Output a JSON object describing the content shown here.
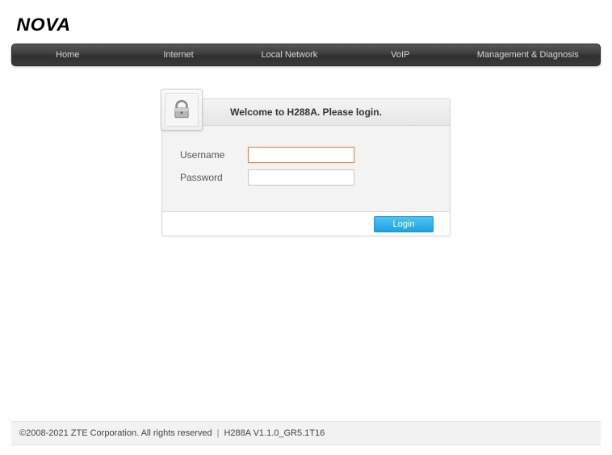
{
  "brand": "NOVA",
  "nav": {
    "items": [
      "Home",
      "Internet",
      "Local Network",
      "VoIP",
      "Management & Diagnosis"
    ]
  },
  "login": {
    "welcome": "Welcome to H288A. Please login.",
    "username_label": "Username",
    "password_label": "Password",
    "username_value": "",
    "password_value": "",
    "button": "Login",
    "icon": "lock-icon"
  },
  "footer": {
    "copyright": "©2008-2021 ZTE Corporation. All rights reserved",
    "separator": "|",
    "version": "H288A V1.1.0_GR5.1T16"
  }
}
